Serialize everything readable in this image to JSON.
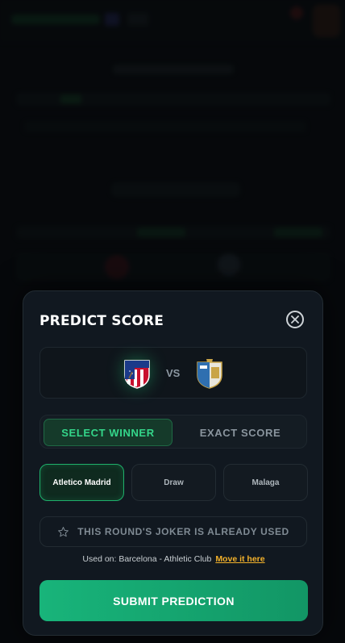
{
  "modal": {
    "title": "PREDICT SCORE",
    "close_icon": "close-icon"
  },
  "match": {
    "home_team": "Atletico Madrid",
    "away_team": "Malaga",
    "vs_label": "VS",
    "home_crest_icon": "atletico-crest-icon",
    "away_crest_icon": "malaga-crest-icon"
  },
  "mode_toggle": {
    "options": [
      "SELECT WINNER",
      "EXACT SCORE"
    ],
    "selected": "SELECT WINNER"
  },
  "winner_choices": {
    "options": [
      "Atletico Madrid",
      "Draw",
      "Malaga"
    ],
    "selected": "Atletico Madrid"
  },
  "joker": {
    "label": "THIS ROUND'S JOKER IS ALREADY USED",
    "icon": "star-icon"
  },
  "used_on": {
    "text": "Used on: Barcelona - Athletic Club",
    "link": "Move it here"
  },
  "submit_label": "SUBMIT PREDICTION",
  "colors": {
    "accent": "#1fb06b",
    "link": "#f2b12b",
    "modal_bg": "#111820"
  }
}
